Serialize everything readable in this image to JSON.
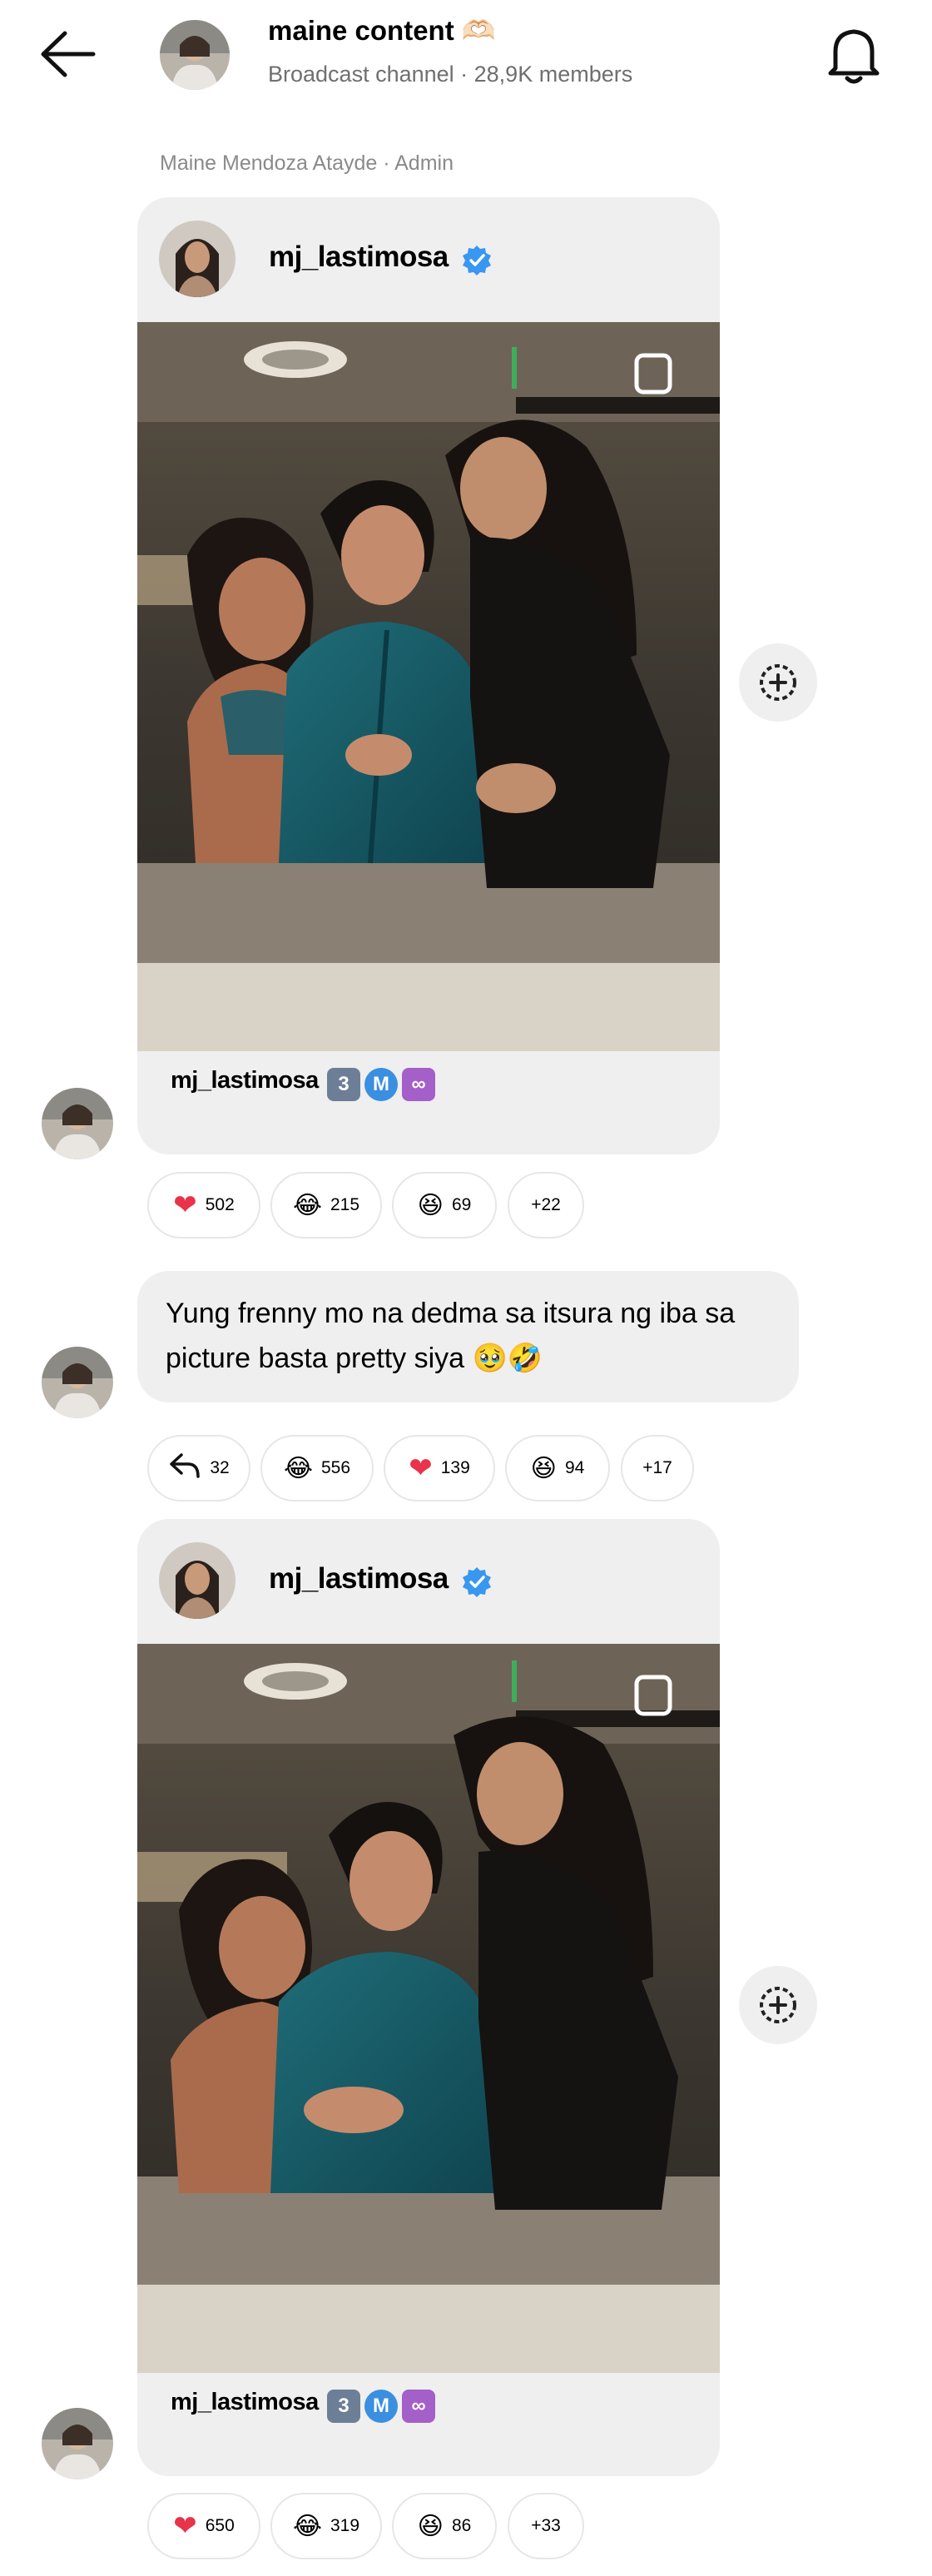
{
  "header": {
    "channel_name": "maine content 🫶🏻",
    "channel_subtitle": "Broadcast channel · 28,9K members",
    "admin_label": "Maine Mendoza Atayde · Admin"
  },
  "posts": [
    {
      "account_name": "mj_lastimosa",
      "caption_name": "mj_lastimosa",
      "caption_badges": [
        "3",
        "M",
        "∞"
      ],
      "reactions": [
        {
          "icon": "heart-emoji",
          "glyph": "❤",
          "count": "502"
        },
        {
          "icon": "laughing-tears-emoji",
          "glyph": "😂",
          "count": "215"
        },
        {
          "icon": "grinning-squint-emoji",
          "glyph": "😆",
          "count": "69"
        },
        {
          "icon": "more-reactions",
          "glyph": "",
          "count": "+22"
        }
      ]
    },
    {
      "account_name": "mj_lastimosa",
      "caption_name": "mj_lastimosa",
      "caption_badges": [
        "3",
        "M",
        "∞"
      ],
      "reactions": [
        {
          "icon": "heart-emoji",
          "glyph": "❤",
          "count": "650"
        },
        {
          "icon": "laughing-tears-emoji",
          "glyph": "😂",
          "count": "319"
        },
        {
          "icon": "grinning-squint-emoji",
          "glyph": "😆",
          "count": "86"
        },
        {
          "icon": "more-reactions",
          "glyph": "",
          "count": "+33"
        }
      ]
    }
  ],
  "text_message": {
    "text": "Yung frenny mo na dedma sa itsura ng iba sa picture basta pretty siya 🥹🤣",
    "reactions": [
      {
        "icon": "reply-icon",
        "glyph": "",
        "count": "32"
      },
      {
        "icon": "laughing-tears-emoji",
        "glyph": "😂",
        "count": "556"
      },
      {
        "icon": "heart-emoji",
        "glyph": "❤",
        "count": "139"
      },
      {
        "icon": "grinning-squint-emoji",
        "glyph": "😆",
        "count": "94"
      },
      {
        "icon": "more-reactions",
        "glyph": "",
        "count": "+17"
      }
    ]
  },
  "colors": {
    "bubble_bg": "#efefef",
    "verified_blue": "#3897f0",
    "heart_red": "#e8334a",
    "muted_text": "#6f6f6f"
  }
}
